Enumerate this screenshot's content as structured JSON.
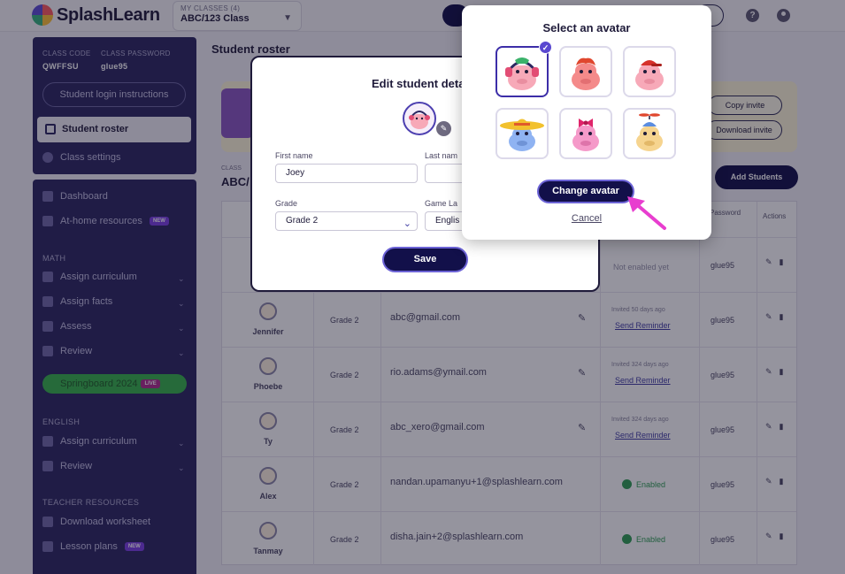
{
  "brand": {
    "name": "SplashLearn"
  },
  "header": {
    "class_select_label": "MY CLASSES (4)",
    "class_select_value": "ABC/123 Class"
  },
  "sidebar": {
    "class_code_label": "CLASS CODE",
    "class_code_value": "QWFFSU",
    "class_password_label": "CLASS PASSWORD",
    "class_password_value": "glue95",
    "login_instructions": "Student login instructions",
    "roster": "Student roster",
    "class_settings": "Class settings",
    "dashboard": "Dashboard",
    "at_home": "At-home resources",
    "new_badge": "NEW",
    "math_section": "MATH",
    "math_items": [
      "Assign curriculum",
      "Assign facts",
      "Assess",
      "Review"
    ],
    "springboard": "Springboard 2024",
    "live_badge": "LIVE",
    "english_section": "ENGLISH",
    "english_items": [
      "Assign curriculum",
      "Review"
    ],
    "teacher_section": "TEACHER RESOURCES",
    "download_worksheet": "Download worksheet",
    "lesson_plans": "Lesson plans"
  },
  "main": {
    "title": "Student roster",
    "copy_invite": "Copy invite",
    "download_invite": "Download invite",
    "class_label": "CLASS",
    "class_name": "ABC/",
    "add_students": "Add Students",
    "col_password": "Password",
    "col_actions": "Actions",
    "first_row_status": "Not enabled yet",
    "first_row_password": "glue95",
    "rows": [
      {
        "name": "Jennifer",
        "grade": "Grade 2",
        "email": "abc@gmail.com",
        "status": "Invited 50 days ago",
        "action": "Send Reminder",
        "password": "glue95"
      },
      {
        "name": "Phoebe",
        "grade": "Grade 2",
        "email": "rio.adams@ymail.com",
        "status": "Invited 324 days ago",
        "action": "Send Reminder",
        "password": "glue95"
      },
      {
        "name": "Ty",
        "grade": "Grade 2",
        "email": "abc_xero@gmail.com",
        "status": "Invited 324 days ago",
        "action": "Send Reminder",
        "password": "glue95"
      },
      {
        "name": "Alex",
        "grade": "Grade 2",
        "email": "nandan.upamanyu+1@splashlearn.com",
        "status": "Enabled",
        "password": "glue95"
      },
      {
        "name": "Tanmay",
        "grade": "Grade 2",
        "email": "disha.jain+2@splashlearn.com",
        "status": "Enabled",
        "password": "glue95"
      }
    ]
  },
  "edit_dialog": {
    "title": "Edit student deta",
    "first_name_label": "First name",
    "first_name_value": "Joey",
    "last_name_label": "Last nam",
    "grade_label": "Grade",
    "grade_value": "Grade 2",
    "game_lang_label": "Game La",
    "game_lang_value": "Englis",
    "save": "Save"
  },
  "avatar_dialog": {
    "title": "Select an avatar",
    "avatars": [
      "hippo-headphones",
      "hippo-red-hair",
      "hippo-red-cap",
      "hippo-sombrero",
      "hippo-bow",
      "hippo-propeller-hat"
    ],
    "selected_index": 0,
    "change": "Change avatar",
    "cancel": "Cancel"
  },
  "colors": {
    "accent": "#12104a",
    "sidebar": "#2b2660",
    "pointer": "#e83ecf"
  }
}
